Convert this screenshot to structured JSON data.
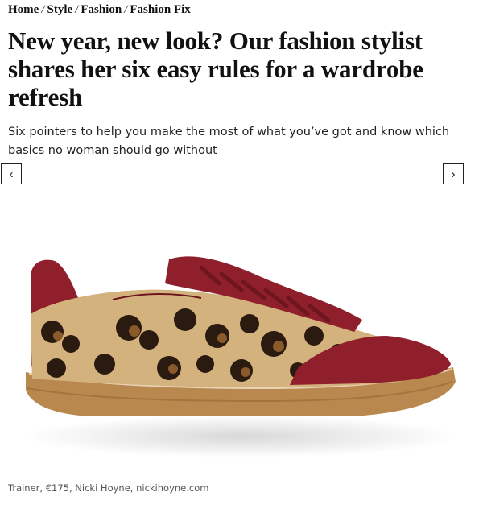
{
  "breadcrumb": {
    "items": [
      "Home",
      "Style",
      "Fashion",
      "Fashion Fix"
    ],
    "separator": "/"
  },
  "article": {
    "headline": "New year, new look? Our fashion stylist shares her six easy rules for a wardrobe refresh",
    "standfirst": "Six pointers to help you make the most of what you’ve got and know which basics no woman should go without"
  },
  "gallery": {
    "prev_icon": "‹",
    "next_icon": "›",
    "image_subject": "leopard-print pony-hair trainer with burgundy suede and gum sole",
    "colors": {
      "burgundy": "#8f1f2b",
      "gum": "#b9884f",
      "leopard_base": "#c9a56f"
    }
  },
  "caption": "Trainer, €175, Nicki Hoyne, nickihoyne.com"
}
